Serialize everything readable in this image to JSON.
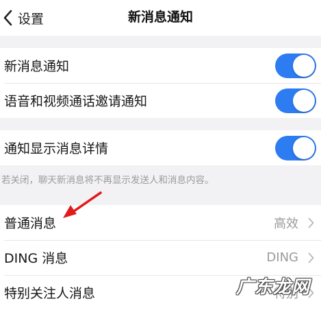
{
  "nav": {
    "back_label": "设置",
    "title": "新消息通知"
  },
  "group1": [
    {
      "label": "新消息通知",
      "toggle_on": true
    },
    {
      "label": "语音和视频通话邀请通知",
      "toggle_on": true
    }
  ],
  "group2": [
    {
      "label": "通知显示消息详情",
      "toggle_on": true
    }
  ],
  "hint": "若关闭，聊天新消息将不再显示发送人和消息内容。",
  "group3": [
    {
      "label": "普通消息",
      "value": "高效"
    },
    {
      "label": "DING 消息",
      "value": "DING"
    },
    {
      "label": "特别关注人消息",
      "value": "特别"
    }
  ],
  "watermark": "广东龙网",
  "colors": {
    "toggle_on": "#2d7cf2",
    "annotation_arrow": "#e01b1b"
  }
}
